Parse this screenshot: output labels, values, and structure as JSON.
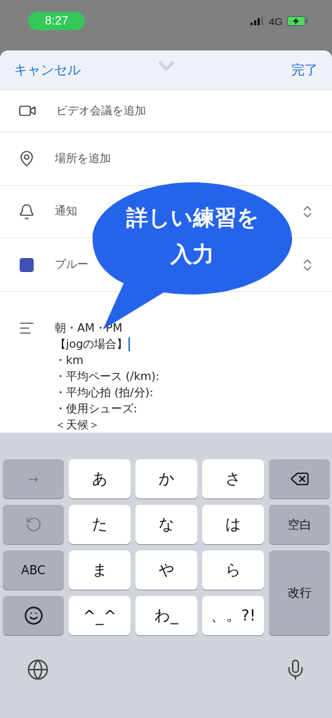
{
  "status_bar": {
    "time": "8:27",
    "network": "4G"
  },
  "header": {
    "cancel": "キャンセル",
    "done": "完了"
  },
  "rows": [
    {
      "kind": "video",
      "label": "ビデオ会議を追加"
    },
    {
      "kind": "location",
      "label": "場所を追加"
    },
    {
      "kind": "notification",
      "label": "通知"
    },
    {
      "kind": "color",
      "label": "ブルー",
      "color": "#3f51b5"
    }
  ],
  "notes": {
    "lines": [
      "朝・AM・PM",
      "【jogの場合】",
      "・km",
      "・平均ペース (/km):",
      "・平均心拍 (拍/分):",
      "・使用シューズ:",
      "＜天候＞"
    ]
  },
  "callout": {
    "lines": [
      "詳しい練習を",
      "入力"
    ]
  },
  "keyboard": {
    "tab_key": "→",
    "letter_keys": [
      "あ",
      "か",
      "さ",
      "た",
      "な",
      "は",
      "ま",
      "や",
      "ら",
      "^_^",
      "わ_",
      "、。?!"
    ],
    "abc_key": "ABC",
    "space_key": "空白",
    "return_key": "改行"
  }
}
